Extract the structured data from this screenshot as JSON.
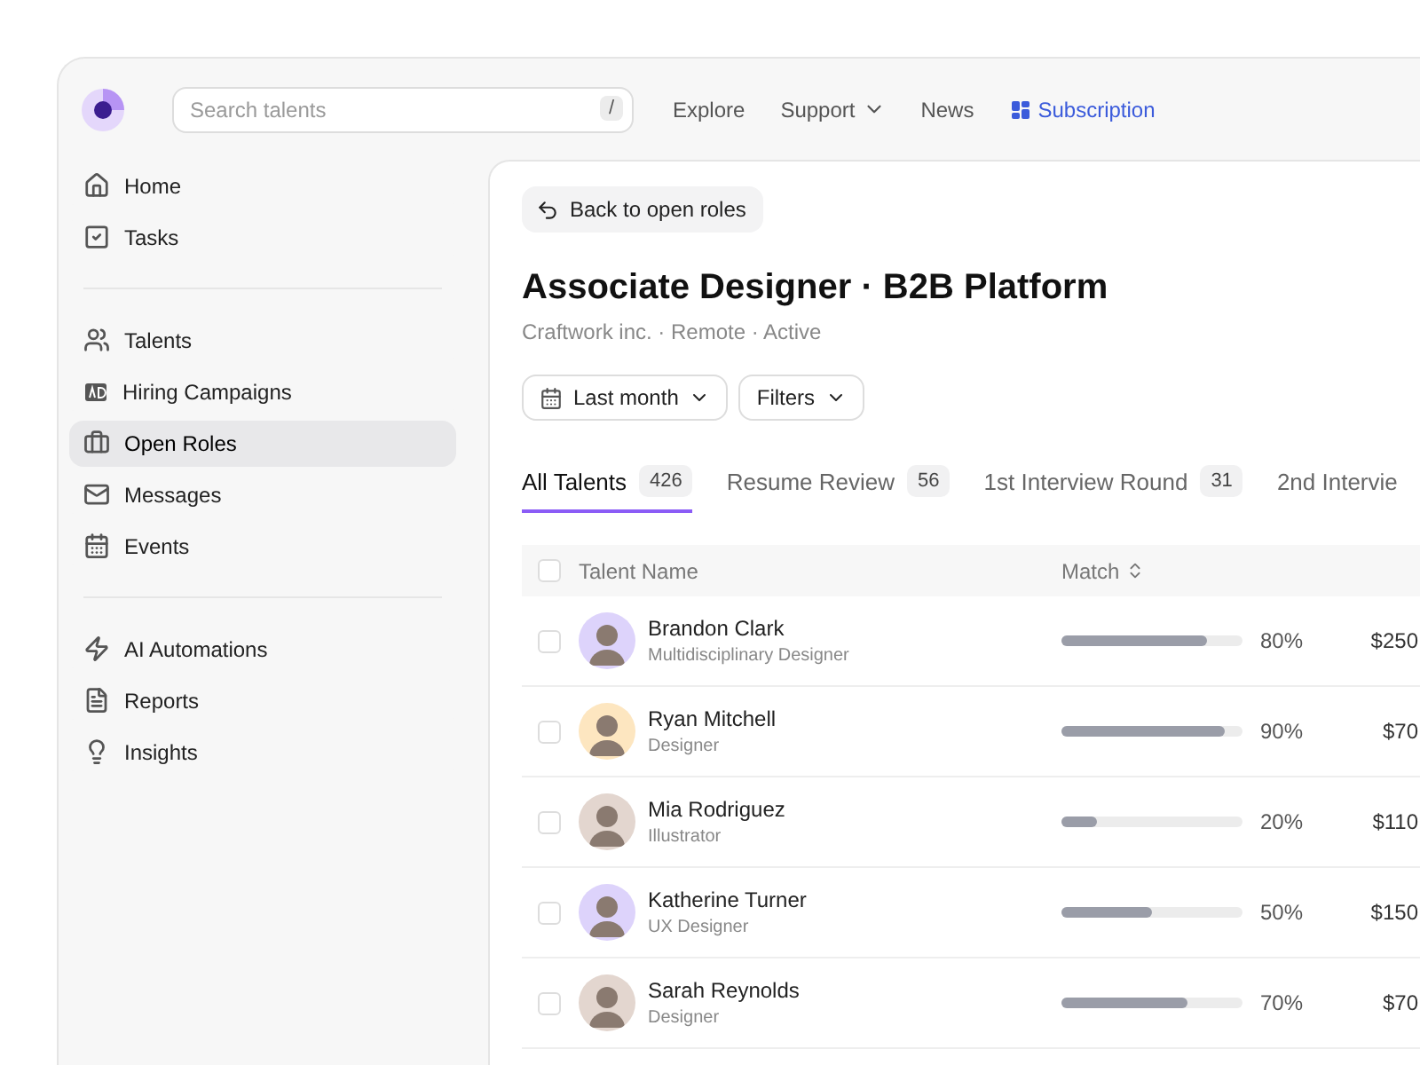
{
  "topbar": {
    "search": {
      "placeholder": "Search talents",
      "shortcut": "/"
    },
    "links": [
      {
        "label": "Explore",
        "kind": "plain"
      },
      {
        "label": "Support",
        "kind": "dropdown"
      },
      {
        "label": "News",
        "kind": "plain"
      },
      {
        "label": "Subscription",
        "kind": "highlight"
      }
    ]
  },
  "sidebar": {
    "items": [
      {
        "label": "Home",
        "selected": false
      },
      {
        "label": "Tasks",
        "selected": false
      },
      {
        "label": "Talents",
        "selected": false
      },
      {
        "label": "Hiring Campaigns",
        "selected": false
      },
      {
        "label": "Open Roles",
        "selected": true
      },
      {
        "label": "Messages",
        "selected": false
      },
      {
        "label": "Events",
        "selected": false
      },
      {
        "label": "AI Automations",
        "selected": false
      },
      {
        "label": "Reports",
        "selected": false
      },
      {
        "label": "Insights",
        "selected": false
      }
    ]
  },
  "main": {
    "back_button": "Back to open roles",
    "title": "Associate Designer · B2B Platform",
    "subtitle": "Craftwork inc. · Remote · Active",
    "filters": [
      {
        "label": "Last month",
        "kind": "date"
      },
      {
        "label": "Filters",
        "kind": "plain"
      }
    ],
    "tabs": [
      {
        "label": "All Talents",
        "count": "426",
        "selected": true
      },
      {
        "label": "Resume Review",
        "count": "56",
        "selected": false
      },
      {
        "label": "1st Interview Round",
        "count": "31",
        "selected": false
      },
      {
        "label": "2nd Intervie",
        "selected": false
      }
    ],
    "table": {
      "columns": [
        "Talent Name",
        "Match"
      ],
      "header_checked": false,
      "rows": [
        {
          "name": "Brandon Clark",
          "role": "Multidisciplinary Designer",
          "color": "#ddd3fb",
          "level": 0.8,
          "match": "80%",
          "column_4": "$250",
          "checked": false
        },
        {
          "name": "Ryan Mitchell",
          "role": "Designer",
          "color": "#fde6c0",
          "level": 0.9,
          "match": "90%",
          "column_4": "$70",
          "checked": false
        },
        {
          "name": "Mia Rodriguez",
          "role": "Illustrator",
          "color": "#e3d6cf",
          "level": 0.2,
          "match": "20%",
          "column_4": "$110",
          "checked": false
        },
        {
          "name": "Katherine Turner",
          "role": "UX Designer",
          "color": "#ddd3fb",
          "level": 0.5,
          "match": "50%",
          "column_4": "$150",
          "checked": false
        },
        {
          "name": "Sarah Reynolds",
          "role": "Designer",
          "color": "#e3d6cf",
          "level": 0.7,
          "match": "70%",
          "column_4": "$70",
          "checked": false
        }
      ]
    }
  }
}
